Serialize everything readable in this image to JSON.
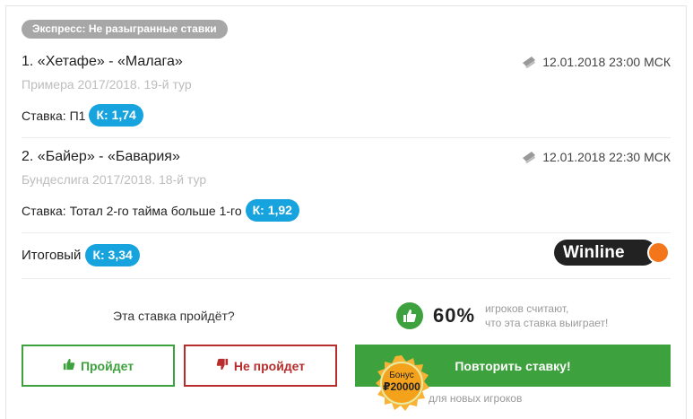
{
  "tag": "Экспресс: Не разыгранные ставки",
  "bets": [
    {
      "title": "1. «Хетафе» - «Малага»",
      "date": "12.01.2018 23:00 МСК",
      "league": "Примера 2017/2018. 19-й тур",
      "stake_label": "Ставка: П1",
      "coef": "К: 1,74"
    },
    {
      "title": "2. «Байер» - «Бавария»",
      "date": "12.01.2018 22:30 МСК",
      "league": "Бундеслига 2017/2018. 18-й тур",
      "stake_label": "Ставка: Тотал 2-го тайма больше 1-го",
      "coef": "К: 1,92"
    }
  ],
  "total": {
    "label": "Итоговый",
    "coef": "К: 3,34"
  },
  "bookmaker": {
    "name": "Winline",
    "accent": "#f4761b"
  },
  "poll": {
    "question": "Эта ставка пройдёт?",
    "percent": "60%",
    "line1": "игроков считают,",
    "line2": "что эта ставка выиграет!"
  },
  "buttons": {
    "yes": "Пройдет",
    "no": "Не пройдет",
    "repeat": "Повторить ставку!"
  },
  "bonus": {
    "label": "Бонус",
    "amount": "₽20000",
    "note": "для новых игроков"
  },
  "colors": {
    "green": "#3da23d",
    "red": "#b72c2c",
    "blue": "#17a3dd",
    "orange": "#f4a21c"
  }
}
